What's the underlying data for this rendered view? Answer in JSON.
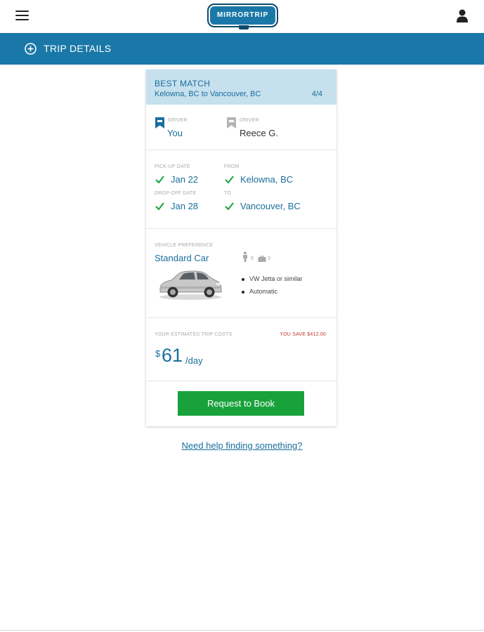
{
  "header": {
    "logo_text": "MIRRORTRIP",
    "menu_icon": "hamburger-menu-icon",
    "user_icon": "user-account-icon"
  },
  "trip_bar": {
    "label": "TRIP DETAILS",
    "icon": "plus-circle-icon"
  },
  "card": {
    "match_label": "BEST MATCH",
    "route": "Kelowna, BC to Vancouver, BC",
    "count": "4/4",
    "drivers": [
      {
        "tiny": "DRIVER",
        "name": "You",
        "icon": "driver-flag-icon"
      },
      {
        "tiny": "DRIVER",
        "name": "Reece G.",
        "icon": "driver-flag-icon"
      }
    ],
    "pickup": {
      "tiny": "PICK-UP DATE",
      "value": "Jan 22"
    },
    "from": {
      "tiny": "FROM",
      "value": "Kelowna, BC"
    },
    "dropoff": {
      "tiny": "DROP-OFF DATE",
      "value": "Jan 28"
    },
    "to": {
      "tiny": "TO",
      "value": "Vancouver, BC"
    },
    "vehicle": {
      "tiny": "VEHICLE PREFERENCE",
      "name": "Standard Car",
      "seats": "5",
      "bags": "3",
      "features": [
        "VW Jetta or similar",
        "Automatic"
      ]
    },
    "cost": {
      "tiny": "YOUR ESTIMATED TRIP COSTS",
      "savings": "YOU SAVE $412.00",
      "currency": "$",
      "amount": "61",
      "unit": "/day"
    },
    "book_label": "Request to Book"
  },
  "help_link": "Need help finding something?",
  "colors": {
    "brand_blue": "#1a78a8",
    "header_tint": "#c6e0ee",
    "cta_green": "#19a23c",
    "savings_red": "#c0392b"
  }
}
